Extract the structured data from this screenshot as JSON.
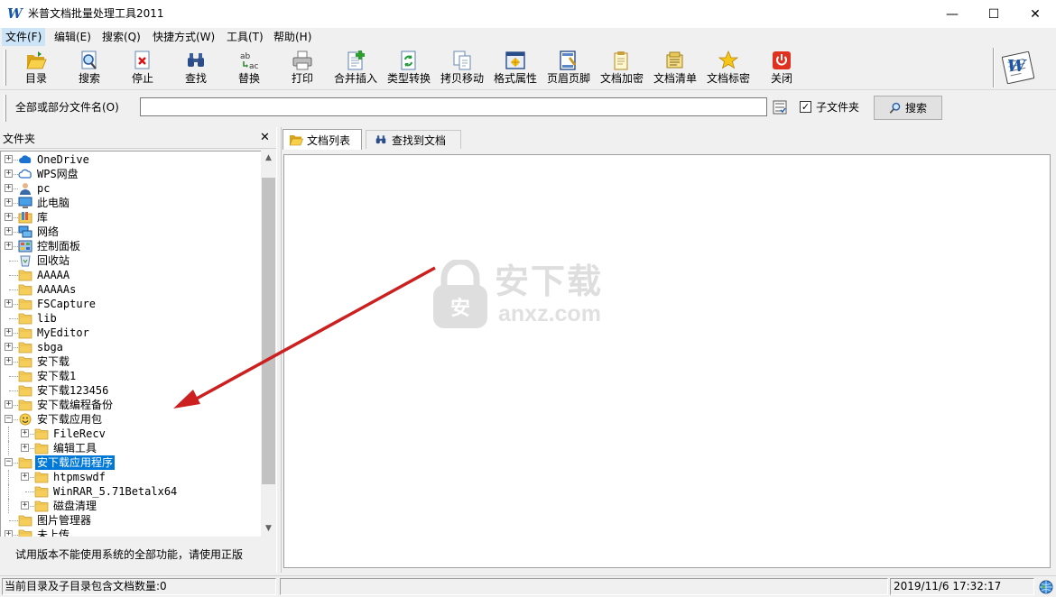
{
  "window": {
    "title": "米普文档批量处理工具2011",
    "logo_text": "W",
    "min_glyph": "—",
    "max_glyph": "☐",
    "close_glyph": "✕"
  },
  "menu": [
    "文件(F)",
    "编辑(E)",
    "搜索(Q)",
    "快捷方式(W)",
    "工具(T)",
    "帮助(H)"
  ],
  "toolbar": [
    {
      "label": "目录",
      "icon": "folder-open-icon"
    },
    {
      "label": "搜索",
      "icon": "search-doc-icon"
    },
    {
      "label": "停止",
      "icon": "stop-icon"
    },
    {
      "label": "查找",
      "icon": "binoculars-icon"
    },
    {
      "label": "替换",
      "icon": "replace-icon"
    },
    {
      "label": "打印",
      "icon": "printer-icon"
    },
    {
      "label": "合并插入",
      "icon": "merge-insert-icon"
    },
    {
      "label": "类型转换",
      "icon": "type-convert-icon"
    },
    {
      "label": "拷贝移动",
      "icon": "copy-move-icon"
    },
    {
      "label": "格式属性",
      "icon": "format-properties-icon"
    },
    {
      "label": "页眉页脚",
      "icon": "header-footer-icon"
    },
    {
      "label": "文档加密",
      "icon": "encrypt-icon"
    },
    {
      "label": "文档清单",
      "icon": "document-list-icon"
    },
    {
      "label": "文档标密",
      "icon": "star-icon"
    },
    {
      "label": "关闭",
      "icon": "power-icon"
    }
  ],
  "search": {
    "label": "全部或部分文件名(O)",
    "value": "",
    "subfolder_label": "子文件夹",
    "subfolder_checked": "✓",
    "button_label": "搜索"
  },
  "folder_pane": {
    "title": "文件夹",
    "close_glyph": "✕",
    "trial_notice": "试用版本不能使用系统的全部功能，请使用正版"
  },
  "tree": [
    {
      "label": "OneDrive",
      "icon": "onedrive-icon",
      "depth": 0,
      "expander": "+"
    },
    {
      "label": "WPS网盘",
      "icon": "cloud-icon",
      "depth": 0,
      "expander": "+"
    },
    {
      "label": "pc",
      "icon": "user-icon",
      "depth": 0,
      "expander": "+"
    },
    {
      "label": "此电脑",
      "icon": "computer-icon",
      "depth": 0,
      "expander": "+"
    },
    {
      "label": "库",
      "icon": "library-icon",
      "depth": 0,
      "expander": "+"
    },
    {
      "label": "网络",
      "icon": "network-icon",
      "depth": 0,
      "expander": "+"
    },
    {
      "label": "控制面板",
      "icon": "control-panel-icon",
      "depth": 0,
      "expander": "+"
    },
    {
      "label": "回收站",
      "icon": "recycle-bin-icon",
      "depth": 0,
      "expander": ""
    },
    {
      "label": "AAAAA",
      "icon": "folder-icon",
      "depth": 0,
      "expander": ""
    },
    {
      "label": "AAAAAs",
      "icon": "folder-icon",
      "depth": 0,
      "expander": ""
    },
    {
      "label": "FSCapture",
      "icon": "folder-icon",
      "depth": 0,
      "expander": "+"
    },
    {
      "label": "lib",
      "icon": "folder-icon",
      "depth": 0,
      "expander": ""
    },
    {
      "label": "MyEditor",
      "icon": "folder-icon",
      "depth": 0,
      "expander": "+"
    },
    {
      "label": "sbga",
      "icon": "folder-icon",
      "depth": 0,
      "expander": "+"
    },
    {
      "label": "安下载",
      "icon": "folder-icon",
      "depth": 0,
      "expander": "+"
    },
    {
      "label": "安下载1",
      "icon": "folder-icon",
      "depth": 0,
      "expander": ""
    },
    {
      "label": "安下载123456",
      "icon": "folder-icon",
      "depth": 0,
      "expander": ""
    },
    {
      "label": "安下载编程备份",
      "icon": "folder-icon",
      "depth": 0,
      "expander": "+"
    },
    {
      "label": "安下载应用包",
      "icon": "smiley-folder-icon",
      "depth": 0,
      "expander": "−"
    },
    {
      "label": "FileRecv",
      "icon": "folder-icon",
      "depth": 1,
      "expander": "+"
    },
    {
      "label": "编辑工具",
      "icon": "folder-icon",
      "depth": 1,
      "expander": "+"
    },
    {
      "label": "安下载应用程序",
      "icon": "folder-icon",
      "depth": 0,
      "expander": "−",
      "selected": true
    },
    {
      "label": "htpmswdf",
      "icon": "folder-icon",
      "depth": 1,
      "expander": "+"
    },
    {
      "label": "WinRAR_5.71Betalx64",
      "icon": "folder-icon",
      "depth": 1,
      "expander": ""
    },
    {
      "label": "磁盘清理",
      "icon": "folder-icon",
      "depth": 1,
      "expander": "+"
    },
    {
      "label": "图片管理器",
      "icon": "folder-icon",
      "depth": 0,
      "expander": ""
    },
    {
      "label": "未上传",
      "icon": "folder-icon",
      "depth": 0,
      "expander": "+"
    }
  ],
  "tabs": [
    {
      "label": "文档列表",
      "icon": "folder-open-icon",
      "active": true
    },
    {
      "label": "查找到文档",
      "icon": "binoculars-icon",
      "active": false
    }
  ],
  "watermark": {
    "text": "安下载",
    "subtext": "anxz.com",
    "badge": "安"
  },
  "status": {
    "doc_count": "当前目录及子目录包含文档数量:0",
    "datetime": "2019/11/6 17:32:17"
  }
}
